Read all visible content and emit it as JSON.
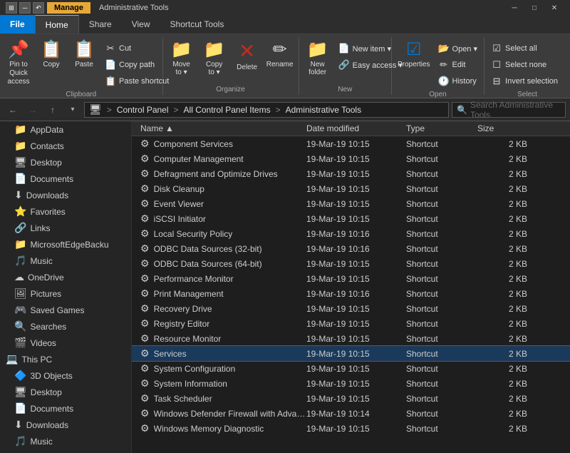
{
  "titleBar": {
    "title": "Administrative Tools",
    "manageTab": "Manage",
    "windowControls": [
      "─",
      "□",
      "✕"
    ]
  },
  "ribbonTabs": [
    {
      "id": "file",
      "label": "File",
      "class": "file"
    },
    {
      "id": "home",
      "label": "Home",
      "class": "active"
    },
    {
      "id": "share",
      "label": "Share",
      "class": ""
    },
    {
      "id": "view",
      "label": "View",
      "class": ""
    },
    {
      "id": "shortcut",
      "label": "Shortcut Tools",
      "class": ""
    }
  ],
  "ribbon": {
    "groups": [
      {
        "id": "clipboard",
        "label": "Clipboard",
        "items": [
          {
            "id": "pin",
            "icon": "📌",
            "label": "Pin to Quick\naccess",
            "large": true
          },
          {
            "id": "copy",
            "icon": "📋",
            "label": "Copy",
            "large": true
          },
          {
            "id": "paste",
            "icon": "📋",
            "label": "Paste",
            "large": true
          },
          {
            "id": "cut",
            "icon": "✂",
            "label": "Cut",
            "small": true
          },
          {
            "id": "copypath",
            "icon": "📄",
            "label": "Copy path",
            "small": true
          },
          {
            "id": "pasteshortcut",
            "icon": "📋",
            "label": "Paste shortcut",
            "small": true
          }
        ]
      },
      {
        "id": "organize",
        "label": "Organize",
        "items": [
          {
            "id": "moveto",
            "icon": "📁",
            "label": "Move to ▾",
            "large": true
          },
          {
            "id": "copyto",
            "icon": "📁",
            "label": "Copy to ▾",
            "large": true
          },
          {
            "id": "delete",
            "icon": "✕",
            "label": "Delete",
            "large": true
          },
          {
            "id": "rename",
            "icon": "✏",
            "label": "Rename",
            "large": true
          }
        ]
      },
      {
        "id": "new",
        "label": "New",
        "items": [
          {
            "id": "newfolder",
            "icon": "📁",
            "label": "New\nfolder",
            "large": true
          },
          {
            "id": "newitem",
            "icon": "📄",
            "label": "New item ▾",
            "small": true
          },
          {
            "id": "easyaccess",
            "icon": "🔗",
            "label": "Easy access ▾",
            "small": true
          }
        ]
      },
      {
        "id": "open",
        "label": "Open",
        "items": [
          {
            "id": "properties",
            "icon": "🔲",
            "label": "Properties",
            "large": true
          },
          {
            "id": "open",
            "icon": "📂",
            "label": "Open ▾",
            "small": true
          },
          {
            "id": "edit",
            "icon": "✏",
            "label": "Edit",
            "small": true
          },
          {
            "id": "history",
            "icon": "🕐",
            "label": "History",
            "small": true
          }
        ]
      },
      {
        "id": "select",
        "label": "Select",
        "items": [
          {
            "id": "selectall",
            "icon": "☑",
            "label": "Select all",
            "small": true
          },
          {
            "id": "selectnone",
            "icon": "☐",
            "label": "Select none",
            "small": true
          },
          {
            "id": "invertselection",
            "icon": "⊟",
            "label": "Invert selection",
            "small": true
          }
        ]
      }
    ]
  },
  "addressBar": {
    "backDisabled": false,
    "forwardDisabled": true,
    "upDisabled": false,
    "path": [
      "Control Panel",
      "All Control Panel Items",
      "Administrative Tools"
    ],
    "searchPlaceholder": "Search Administrative Tools"
  },
  "sidebar": {
    "items": [
      {
        "id": "appdata",
        "icon": "📁",
        "label": "AppData",
        "indent": 1
      },
      {
        "id": "contacts",
        "icon": "📁",
        "label": "Contacts",
        "indent": 1
      },
      {
        "id": "desktop",
        "icon": "🖥",
        "label": "Desktop",
        "indent": 1
      },
      {
        "id": "documents",
        "icon": "📄",
        "label": "Documents",
        "indent": 1
      },
      {
        "id": "downloads",
        "icon": "⬇",
        "label": "Downloads",
        "indent": 1
      },
      {
        "id": "favorites",
        "icon": "⭐",
        "label": "Favorites",
        "indent": 1
      },
      {
        "id": "links",
        "icon": "🔗",
        "label": "Links",
        "indent": 1
      },
      {
        "id": "msedgebackup",
        "icon": "📁",
        "label": "MicrosoftEdgeBacku",
        "indent": 1
      },
      {
        "id": "music",
        "icon": "🎵",
        "label": "Music",
        "indent": 1
      },
      {
        "id": "onedrive",
        "icon": "☁",
        "label": "OneDrive",
        "indent": 1
      },
      {
        "id": "pictures",
        "icon": "🖼",
        "label": "Pictures",
        "indent": 1
      },
      {
        "id": "savedgames",
        "icon": "🎮",
        "label": "Saved Games",
        "indent": 1
      },
      {
        "id": "searches",
        "icon": "🔍",
        "label": "Searches",
        "indent": 1
      },
      {
        "id": "videos",
        "icon": "🎬",
        "label": "Videos",
        "indent": 1
      },
      {
        "id": "thispc",
        "icon": "💻",
        "label": "This PC",
        "indent": 0
      },
      {
        "id": "3dobjects",
        "icon": "🔷",
        "label": "3D Objects",
        "indent": 1
      },
      {
        "id": "desktoppc",
        "icon": "🖥",
        "label": "Desktop",
        "indent": 1
      },
      {
        "id": "documentspc",
        "icon": "📄",
        "label": "Documents",
        "indent": 1
      },
      {
        "id": "downloadspc",
        "icon": "⬇",
        "label": "Downloads",
        "indent": 1
      },
      {
        "id": "musicpc",
        "icon": "🎵",
        "label": "Music",
        "indent": 1
      }
    ]
  },
  "fileList": {
    "columns": [
      {
        "id": "name",
        "label": "Name",
        "sort": "asc"
      },
      {
        "id": "date",
        "label": "Date modified"
      },
      {
        "id": "type",
        "label": "Type"
      },
      {
        "id": "size",
        "label": "Size"
      }
    ],
    "rows": [
      {
        "id": 1,
        "icon": "⚙",
        "name": "Component Services",
        "date": "19-Mar-19 10:15",
        "type": "Shortcut",
        "size": "2 KB",
        "selected": false
      },
      {
        "id": 2,
        "icon": "⚙",
        "name": "Computer Management",
        "date": "19-Mar-19 10:15",
        "type": "Shortcut",
        "size": "2 KB",
        "selected": false
      },
      {
        "id": 3,
        "icon": "⚙",
        "name": "Defragment and Optimize Drives",
        "date": "19-Mar-19 10:15",
        "type": "Shortcut",
        "size": "2 KB",
        "selected": false
      },
      {
        "id": 4,
        "icon": "⚙",
        "name": "Disk Cleanup",
        "date": "19-Mar-19 10:15",
        "type": "Shortcut",
        "size": "2 KB",
        "selected": false
      },
      {
        "id": 5,
        "icon": "⚙",
        "name": "Event Viewer",
        "date": "19-Mar-19 10:15",
        "type": "Shortcut",
        "size": "2 KB",
        "selected": false
      },
      {
        "id": 6,
        "icon": "⚙",
        "name": "iSCSI Initiator",
        "date": "19-Mar-19 10:15",
        "type": "Shortcut",
        "size": "2 KB",
        "selected": false
      },
      {
        "id": 7,
        "icon": "⚙",
        "name": "Local Security Policy",
        "date": "19-Mar-19 10:16",
        "type": "Shortcut",
        "size": "2 KB",
        "selected": false
      },
      {
        "id": 8,
        "icon": "⚙",
        "name": "ODBC Data Sources (32-bit)",
        "date": "19-Mar-19 10:16",
        "type": "Shortcut",
        "size": "2 KB",
        "selected": false
      },
      {
        "id": 9,
        "icon": "⚙",
        "name": "ODBC Data Sources (64-bit)",
        "date": "19-Mar-19 10:15",
        "type": "Shortcut",
        "size": "2 KB",
        "selected": false
      },
      {
        "id": 10,
        "icon": "⚙",
        "name": "Performance Monitor",
        "date": "19-Mar-19 10:15",
        "type": "Shortcut",
        "size": "2 KB",
        "selected": false
      },
      {
        "id": 11,
        "icon": "⚙",
        "name": "Print Management",
        "date": "19-Mar-19 10:16",
        "type": "Shortcut",
        "size": "2 KB",
        "selected": false
      },
      {
        "id": 12,
        "icon": "⚙",
        "name": "Recovery Drive",
        "date": "19-Mar-19 10:15",
        "type": "Shortcut",
        "size": "2 KB",
        "selected": false
      },
      {
        "id": 13,
        "icon": "⚙",
        "name": "Registry Editor",
        "date": "19-Mar-19 10:15",
        "type": "Shortcut",
        "size": "2 KB",
        "selected": false
      },
      {
        "id": 14,
        "icon": "⚙",
        "name": "Resource Monitor",
        "date": "19-Mar-19 10:15",
        "type": "Shortcut",
        "size": "2 KB",
        "selected": false
      },
      {
        "id": 15,
        "icon": "⚙",
        "name": "Services",
        "date": "19-Mar-19 10:15",
        "type": "Shortcut",
        "size": "2 KB",
        "selected": true
      },
      {
        "id": 16,
        "icon": "⚙",
        "name": "System Configuration",
        "date": "19-Mar-19 10:15",
        "type": "Shortcut",
        "size": "2 KB",
        "selected": false
      },
      {
        "id": 17,
        "icon": "⚙",
        "name": "System Information",
        "date": "19-Mar-19 10:15",
        "type": "Shortcut",
        "size": "2 KB",
        "selected": false
      },
      {
        "id": 18,
        "icon": "⚙",
        "name": "Task Scheduler",
        "date": "19-Mar-19 10:15",
        "type": "Shortcut",
        "size": "2 KB",
        "selected": false
      },
      {
        "id": 19,
        "icon": "⚙",
        "name": "Windows Defender Firewall with Advanc...",
        "date": "19-Mar-19 10:14",
        "type": "Shortcut",
        "size": "2 KB",
        "selected": false
      },
      {
        "id": 20,
        "icon": "⚙",
        "name": "Windows Memory Diagnostic",
        "date": "19-Mar-19 10:15",
        "type": "Shortcut",
        "size": "2 KB",
        "selected": false
      }
    ]
  },
  "icons": {
    "back": "←",
    "forward": "→",
    "up": "↑",
    "search": "🔍",
    "sortAsc": "▲",
    "chevronDown": "▾"
  }
}
